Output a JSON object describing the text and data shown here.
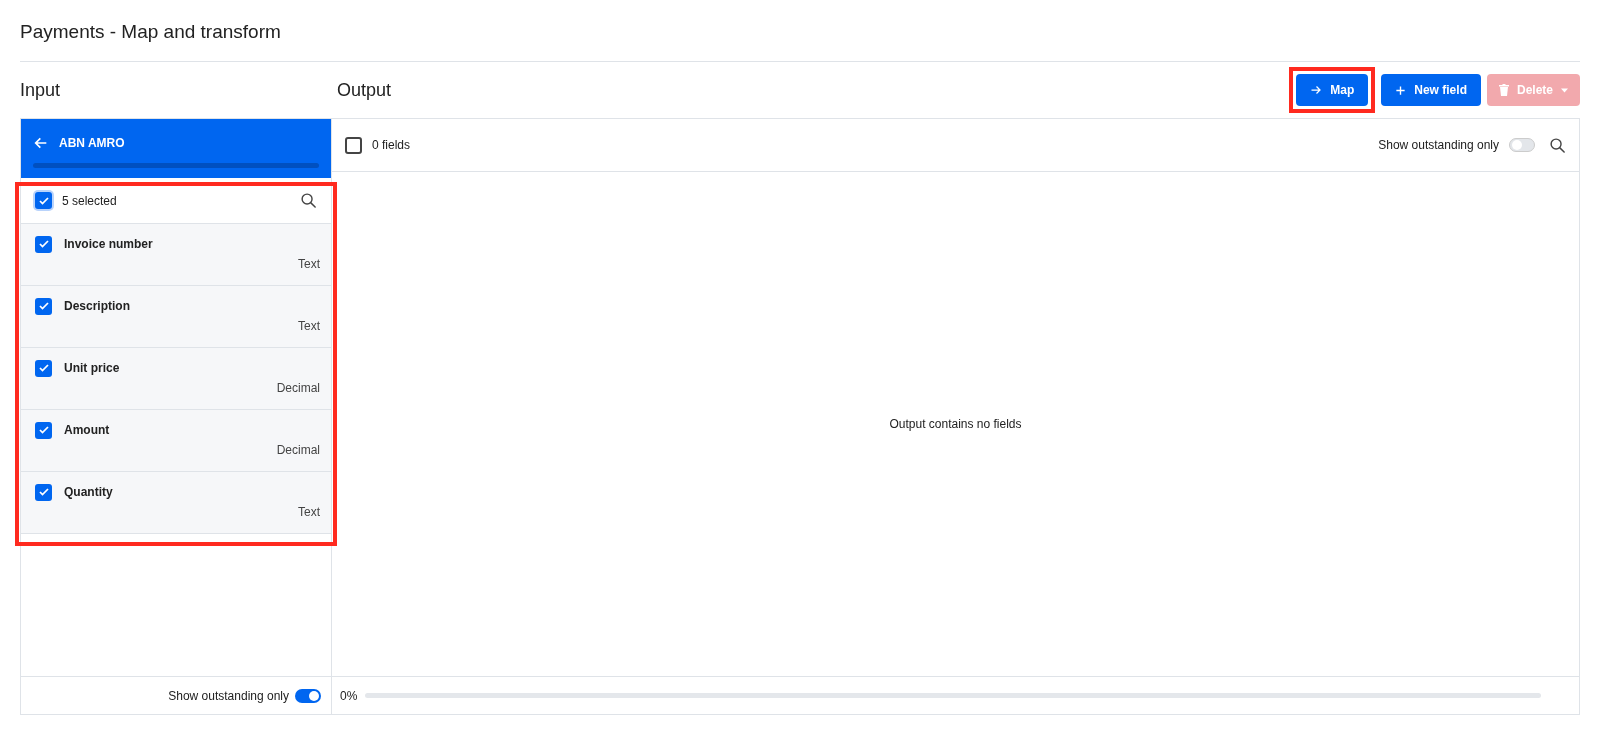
{
  "page_title": "Payments - Map and transform",
  "input": {
    "title": "Input",
    "source": {
      "label": "ABN AMRO"
    },
    "select_all": {
      "label": "5 selected",
      "checked": true
    },
    "fields": [
      {
        "name": "Invoice number",
        "type": "Text",
        "checked": true
      },
      {
        "name": "Description",
        "type": "Text",
        "checked": true
      },
      {
        "name": "Unit price",
        "type": "Decimal",
        "checked": true
      },
      {
        "name": "Amount",
        "type": "Decimal",
        "checked": true
      },
      {
        "name": "Quantity",
        "type": "Text",
        "checked": true
      }
    ],
    "show_outstanding": {
      "label": "Show outstanding only",
      "on": true
    }
  },
  "output": {
    "title": "Output",
    "buttons": [
      {
        "kind": "map",
        "label": "Map",
        "disabled": false
      },
      {
        "kind": "new",
        "label": "New field",
        "disabled": false
      },
      {
        "kind": "delete",
        "label": "Delete",
        "disabled": true
      }
    ],
    "select_all": {
      "label": "0 fields",
      "checked": false
    },
    "show_outstanding": {
      "label": "Show outstanding only",
      "on": false
    },
    "empty_message": "Output contains no fields",
    "progress": {
      "reading": "0%",
      "level": 0
    }
  }
}
